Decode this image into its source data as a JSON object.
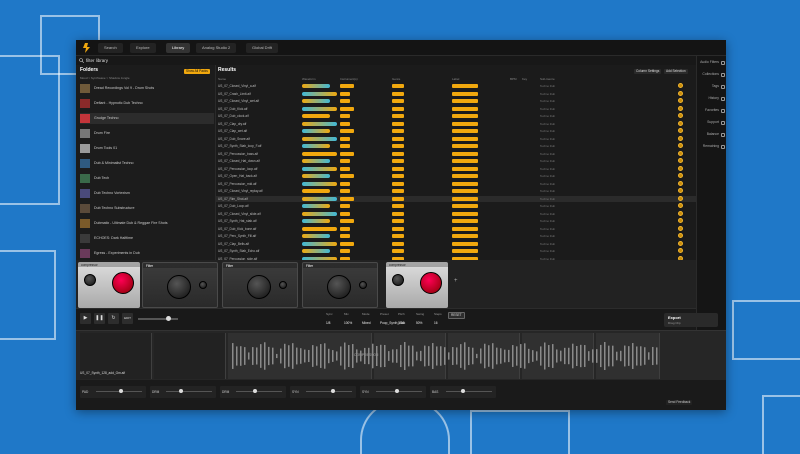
{
  "nav": {
    "tabs": [
      {
        "label": "Search"
      },
      {
        "label": "Explore"
      },
      {
        "label": "Library"
      },
      {
        "label": "Analog Studio 2"
      },
      {
        "label": "Global Drift"
      }
    ]
  },
  "search": {
    "query": "filter library"
  },
  "folders": {
    "title": "Folders",
    "show_all_label": "Show All Packs",
    "breadcrumb": "Mood  >  Synthwave  >  Shadow Jungle",
    "items": [
      {
        "name": "Dread Recordings Vol 9 - Drum Shots",
        "color": "#6f5a3a"
      },
      {
        "name": "Defiant - Hypnotic Dub Techno",
        "color": "#8a2a2a"
      },
      {
        "name": "Grudge Techno",
        "color": "#c3353a"
      },
      {
        "name": "Drum Fire",
        "color": "#777777"
      },
      {
        "name": "Drum Tools 01",
        "color": "#9a9a9a"
      },
      {
        "name": "Dub & Minimalist Techno",
        "color": "#2f5a80"
      },
      {
        "name": "Dub Tech",
        "color": "#3a6a4a"
      },
      {
        "name": "Dub Techno Vortexism",
        "color": "#4a4a7a"
      },
      {
        "name": "Dub Techno Substructure",
        "color": "#5a4a3a"
      },
      {
        "name": "Dubmatix - Ultimate Dub & Reggae Fire Shots",
        "color": "#7a5a2a"
      },
      {
        "name": "ECHOES: Dark Halftime",
        "color": "#3a3a3a"
      },
      {
        "name": "Egress - Experiments in Dub",
        "color": "#6a3a5a"
      },
      {
        "name": "Elements 88 - Techno Kicks",
        "color": "#8a6a3a"
      }
    ]
  },
  "results": {
    "title": "Results",
    "btn_refine": "Column Settings",
    "btn_add": "Add Selection",
    "columns": [
      "Name",
      "Waveform",
      "Instrument(s)",
      "Genre",
      "Label",
      "BPM",
      "Key",
      "Sub-Genre"
    ],
    "rows": [
      {
        "name": "US_07_Closed_Vinyl_a.aif",
        "tag1": "Hat",
        "tag2": "Techno",
        "sub": "Techno Dub"
      },
      {
        "name": "US_07_Crash_Limit.aif",
        "tag1": "Cymbal",
        "tag2": "Techno",
        "sub": "Techno Dub"
      },
      {
        "name": "US_07_Closed_Vinyl_wet.aif",
        "tag1": "Hat",
        "tag2": "Techno",
        "sub": "Techno Dub"
      },
      {
        "name": "US_07_Dub_Kick.aif",
        "tag1": "Kick",
        "tag2": "Techno",
        "sub": "Techno Dub"
      },
      {
        "name": "US_07_Dub_clock.aif",
        "tag1": "Perc",
        "tag2": "Techno",
        "sub": "Techno Dub"
      },
      {
        "name": "US_07_Clap_dry.aif",
        "tag1": "Clap",
        "tag2": "Techno",
        "sub": "Techno Dub"
      },
      {
        "name": "US_07_Clap_wet.aif",
        "tag1": "Clap",
        "tag2": "Techno",
        "sub": "Techno Dub"
      },
      {
        "name": "US_07_Dub_Snare.aif",
        "tag1": "Snare",
        "tag2": "Techno",
        "sub": "Techno Dub"
      },
      {
        "name": "US_07_Synth_Stab_loop_F.aif",
        "tag1": "Synth",
        "tag2": "Techno",
        "sub": "Techno Dub"
      },
      {
        "name": "US_07_Percussion_bass.aif",
        "tag1": "Perc",
        "tag2": "Techno",
        "sub": "Techno Dub"
      },
      {
        "name": "US_07_Closed_Hat_down.aif",
        "tag1": "Hat",
        "tag2": "Techno",
        "sub": "Techno Dub"
      },
      {
        "name": "US_07_Percussion_loop.aif",
        "tag1": "Perc",
        "tag2": "Techno",
        "sub": "Techno Dub"
      },
      {
        "name": "US_07_Open_Hat_back.aif",
        "tag1": "Hat",
        "tag2": "Techno",
        "sub": "Techno Dub"
      },
      {
        "name": "US_07_Percussion_mid.aif",
        "tag1": "Perc",
        "tag2": "Techno",
        "sub": "Techno Dub"
      },
      {
        "name": "US_07_Closed_Vinyl_replay.aif",
        "tag1": "Hat",
        "tag2": "Techno",
        "sub": "Techno Dub"
      },
      {
        "name": "US_07_Rim_Shot.aif",
        "tag1": "Rim",
        "tag2": "Techno",
        "sub": "Techno Dub"
      },
      {
        "name": "US_07_Dub_Loop.aif",
        "tag1": "Loop",
        "tag2": "Techno",
        "sub": "Techno Dub"
      },
      {
        "name": "US_07_Closed_Vinyl_slide.aif",
        "tag1": "Hat",
        "tag2": "Techno",
        "sub": "Techno Dub"
      },
      {
        "name": "US_07_Synth_Hat_stab.aif",
        "tag1": "Synth",
        "tag2": "Techno",
        "sub": "Techno Dub"
      },
      {
        "name": "US_07_Dub_Kick_bone.aif",
        "tag1": "Kick",
        "tag2": "Techno",
        "sub": "Techno Dub"
      },
      {
        "name": "US_07_Perc_Synth_Fill.aif",
        "tag1": "Perc",
        "tag2": "Techno",
        "sub": "Techno Dub"
      },
      {
        "name": "US_07_Clap_Bells.aif",
        "tag1": "Clap",
        "tag2": "Techno",
        "sub": "Techno Dub"
      },
      {
        "name": "US_07_Synth_Stab_Echo.aif",
        "tag1": "Synth",
        "tag2": "Techno",
        "sub": "Techno Dub"
      },
      {
        "name": "US_07_Percussion_side.aif",
        "tag1": "Perc",
        "tag2": "Techno",
        "sub": "Techno Dub"
      },
      {
        "name": "US_07_Dub_Stab.aif",
        "tag1": "Stab",
        "tag2": "Techno",
        "sub": "Techno Dub"
      },
      {
        "name": "US_07_Synth_Stab_loop_A.aif",
        "tag1": "Synth",
        "tag2": "Techno",
        "sub": "Techno Dub"
      },
      {
        "name": "US_07_Percussion_dull.aif",
        "tag1": "Perc",
        "tag2": "Techno",
        "sub": "Techno Dub"
      }
    ]
  },
  "right_sidebar": {
    "items": [
      {
        "label": "Audio Filters"
      },
      {
        "label": "Collections"
      },
      {
        "label": "Tags"
      },
      {
        "label": "History"
      },
      {
        "label": "Favorites"
      },
      {
        "label": "Support"
      },
      {
        "label": "Balance"
      },
      {
        "label": "Remaining"
      }
    ]
  },
  "racks": {
    "cards": [
      {
        "title": "compressor",
        "style": "silver"
      },
      {
        "title": "Filter",
        "style": "dark"
      },
      {
        "title": "Filter",
        "style": "dark"
      },
      {
        "title": "Filter",
        "style": "dark"
      },
      {
        "title": "compressor",
        "style": "silver"
      }
    ]
  },
  "transport": {
    "params": [
      {
        "label": "Sync",
        "value": "1/8"
      },
      {
        "label": "Mix",
        "value": "100%"
      },
      {
        "label": "Mode",
        "value": "Mixed"
      },
      {
        "label": "Preset",
        "value": "Poop_Synth_Kick"
      },
      {
        "label": "Pitch",
        "value": "1/16"
      },
      {
        "label": "Swing",
        "value": "50%"
      },
      {
        "label": "Steps",
        "value": "16"
      }
    ],
    "reset": "RESET",
    "export_label": "Export",
    "export_sub": "Drag Clip"
  },
  "lanes": {
    "clip_name": "US_07_Synth_128_add_Gm.aif",
    "center_label": "COMPRESSOR"
  },
  "mixer": {
    "channels": [
      {
        "label": "PAD",
        "level": 0.55
      },
      {
        "label": "DRM",
        "level": 0.3
      },
      {
        "label": "DRM",
        "level": 0.4
      },
      {
        "label": "SYN",
        "level": 0.6
      },
      {
        "label": "SYN",
        "level": 0.45
      },
      {
        "label": "BAS",
        "level": 0.35
      }
    ],
    "footer": "Send Feedback"
  },
  "colors": {
    "accent": "#f1a80e",
    "background": "#1f78c8"
  }
}
